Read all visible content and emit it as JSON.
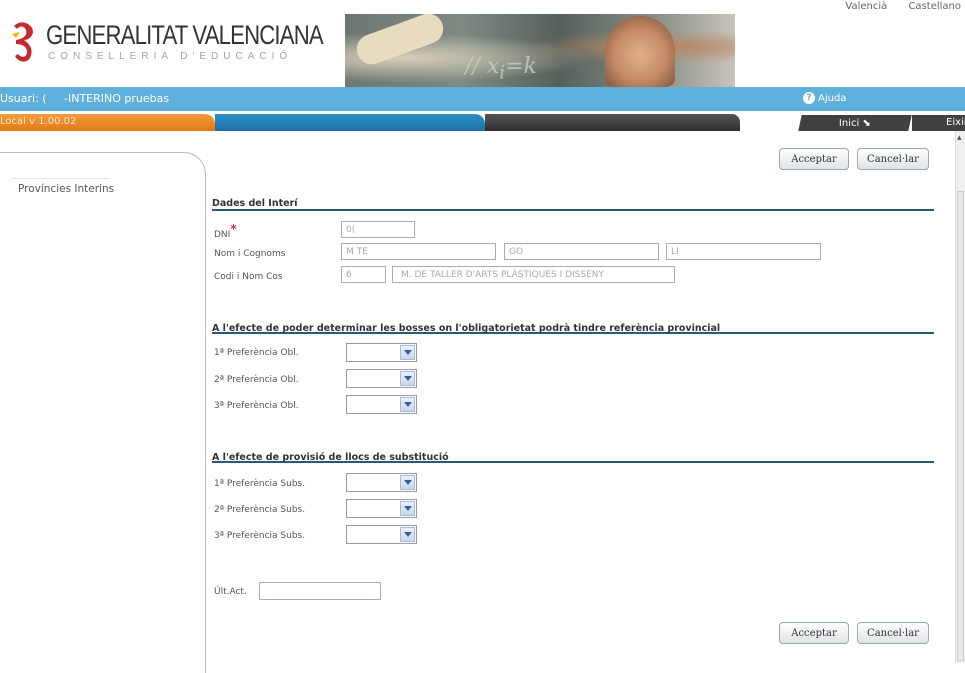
{
  "header": {
    "logo_main": "GENERALITAT VALENCIANA",
    "logo_sub": "CONSELLERIA D'EDUCACIÓ",
    "lang_links": [
      "Valencià",
      "Castellano"
    ]
  },
  "topbar": {
    "user_label": "Usuari: (",
    "user_name": "-INTERINO pruebas",
    "help": "Ajuda"
  },
  "tabbar": {
    "version": "Local v 1.00.02",
    "inici": "Inici",
    "eixir": "Eixir"
  },
  "sidebar": {
    "items": [
      {
        "label": "Províncies Interins"
      }
    ]
  },
  "actions": {
    "accept": "Acceptar",
    "cancel": "Cancel·lar"
  },
  "interi": {
    "section_title": "Dades del Interí",
    "dni_label": "DNI",
    "dni_value": "0(",
    "nom_label": "Nom i Cognoms",
    "nom_value": "M TE",
    "cognom1_value": "GO",
    "cognom2_value": "LI",
    "cos_label": "Codi i Nom Cos",
    "cos_code": "6",
    "cos_name": "M. DE TALLER D'ARTS PLÀSTIQUES I DISSENY"
  },
  "obligatoria": {
    "section_title": "A l'efecte de poder determinar les bosses on l'obligatorietat podrà tindre referència provincial",
    "prefs": [
      {
        "label": "1ª Preferència Obl.",
        "value": ""
      },
      {
        "label": "2ª Preferència Obl.",
        "value": ""
      },
      {
        "label": "3ª Preferència Obl.",
        "value": ""
      }
    ]
  },
  "substitucio": {
    "section_title": "A l'efecte de provisió de llocs de substitució",
    "prefs": [
      {
        "label": "1ª Preferència Subs.",
        "value": ""
      },
      {
        "label": "2ª Preferència Subs.",
        "value": ""
      },
      {
        "label": "3ª Preferència Subs.",
        "value": ""
      }
    ]
  },
  "ultact": {
    "label": "Últ.Act.",
    "value": ""
  }
}
